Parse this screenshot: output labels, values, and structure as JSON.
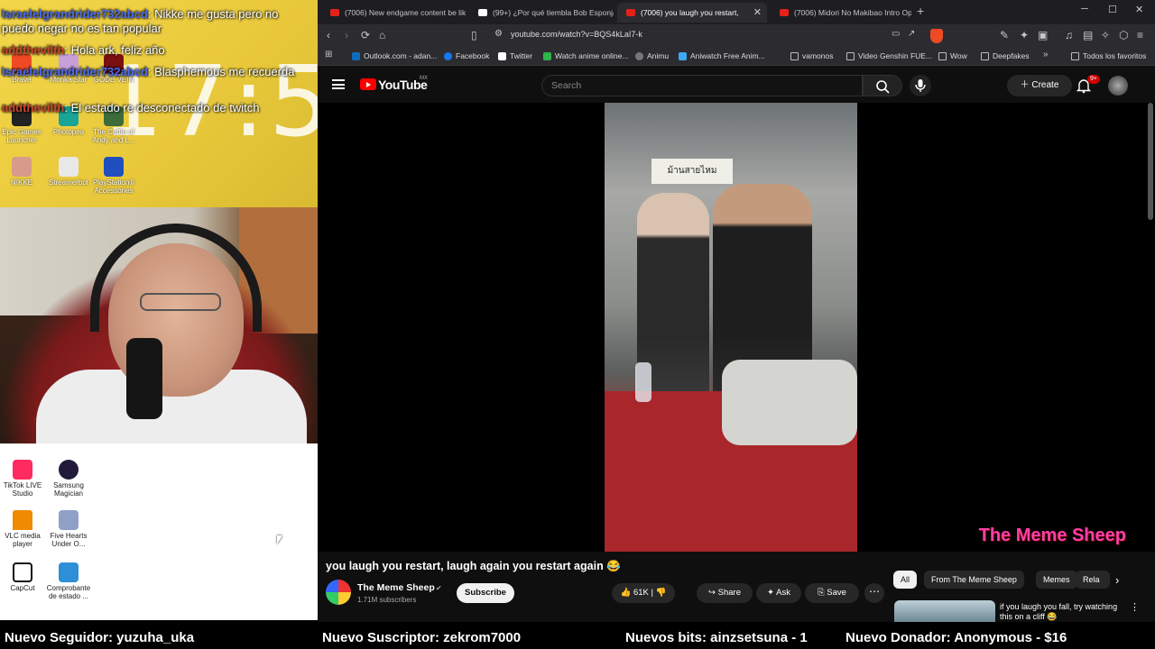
{
  "overlay": {
    "clock": "17:5",
    "chat": [
      {
        "user": "Israelelgrandrider732abcd",
        "message": "Nikke me gusta pero no puedo negar no es tan popular"
      },
      {
        "user": "addthevilth",
        "message": "Hola ark, feliz año"
      },
      {
        "user": "Israelelgrandrider732abcd",
        "message": "Blasphemous me recuerda"
      },
      {
        "user": "addthevilth",
        "message": "El estado re desconectado de twitch"
      }
    ],
    "desktop_icons_top": [
      {
        "label": "Brave"
      },
      {
        "label": "Monka Star"
      },
      {
        "label": "GODE VEIN"
      },
      {
        "label": "Epic Games Launcher"
      },
      {
        "label": "Photopea"
      },
      {
        "label": "The Coffin of Andy and L..."
      },
      {
        "label": "NIKKE"
      },
      {
        "label": "Streamerbot"
      },
      {
        "label": "PlayStation® Accessories"
      }
    ],
    "desktop_icons_bottom": [
      {
        "label": "TikTok LIVE Studio"
      },
      {
        "label": "Samsung Magician"
      },
      {
        "label": "VLC media player"
      },
      {
        "label": "Five Hearts Under O..."
      },
      {
        "label": "CapCut"
      },
      {
        "label": "Comprobante de estado ..."
      }
    ]
  },
  "browser": {
    "tabs": [
      {
        "title": "(7006) New endgame content be like"
      },
      {
        "title": "(99+) ¿Por qué tiembla Bob Esponja?"
      },
      {
        "title": "(7006) you laugh you restart,"
      },
      {
        "title": "(7006) Midori No Makibao Intro Ope"
      }
    ],
    "url": "youtube.com/watch?v=BQS4kLaI7-k",
    "bookmarks": [
      {
        "label": "Outlook.com - adan...",
        "color": "#0f6cbd"
      },
      {
        "label": "Facebook",
        "color": "#1877f2"
      },
      {
        "label": "Twitter",
        "color": "#ffffff"
      },
      {
        "label": "Watch anime online...",
        "color": "#2fb34a"
      },
      {
        "label": "Animu",
        "color": "#777777"
      },
      {
        "label": "Aniwatch Free Anim...",
        "color": "#3fa9f5"
      },
      {
        "label": "vamonos",
        "folder": true
      },
      {
        "label": "Video Genshin FUE...",
        "folder": true
      },
      {
        "label": "Wow",
        "folder": true
      },
      {
        "label": "Deepfakes",
        "folder": true
      },
      {
        "label": "Todos los favoritos",
        "folder": true
      }
    ]
  },
  "youtube": {
    "logo_text": "YouTube",
    "region": "MX",
    "search_placeholder": "Search",
    "create_label": "Create",
    "notif_badge": "9+",
    "video_sign": "ม้านสายไหม",
    "watermark": "The Meme Sheep",
    "title": "you laugh you restart, laugh again you restart again 😂",
    "channel": "The Meme Sheep",
    "verified": "✔",
    "subscribers": "1.71M subscribers",
    "subscribe_label": "Subscribe",
    "likes": "61K",
    "share_label": "Share",
    "ask_label": "Ask",
    "save_label": "Save",
    "chips": [
      "All",
      "From The Meme Sheep",
      "Memes",
      "Rela"
    ],
    "recommended_title": "if you laugh you fall, try watching this on a cliff 😂"
  },
  "ticker": {
    "follower": "Nuevo Seguidor: yuzuha_uka",
    "subscriber": "Nuevo Suscriptor: zekrom7000",
    "bits": "Nuevos bits: ainzsetsuna - 1",
    "donation": "Nuevo Donador: Anonymous - $16"
  }
}
